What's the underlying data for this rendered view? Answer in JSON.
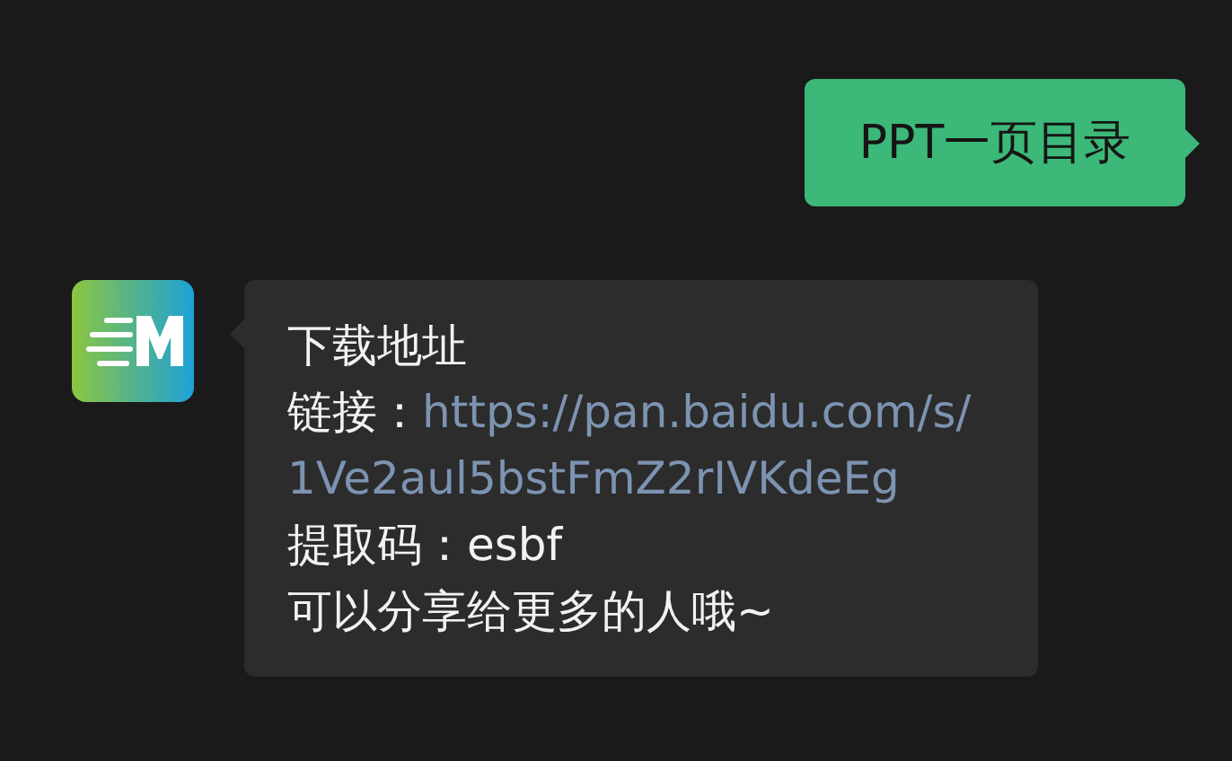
{
  "messages": [
    {
      "kind": "sent",
      "text": "PPT一页目录"
    },
    {
      "kind": "received",
      "lines": [
        {
          "kind": "plain",
          "text": "下载地址"
        },
        {
          "kind": "link",
          "label": "链接：",
          "link": "https://pan.baidu.com/s/1Ve2aul5bstFmZ2rIVKdeEg"
        },
        {
          "kind": "plain",
          "text": "提取码：esbf"
        },
        {
          "kind": "plain",
          "text": "可以分享给更多的人哦~"
        }
      ]
    }
  ]
}
